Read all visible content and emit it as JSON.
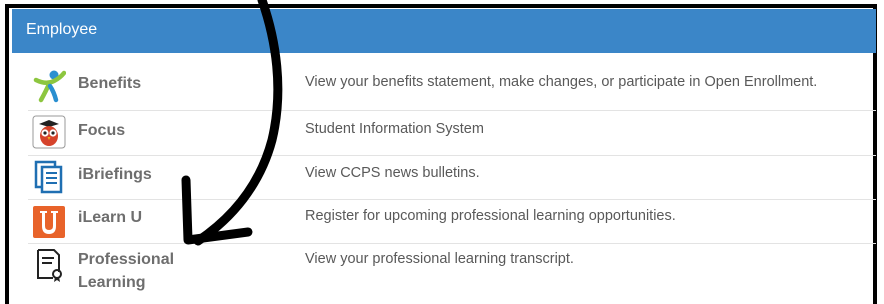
{
  "panel": {
    "title": "Employee"
  },
  "rows": [
    {
      "name": "Benefits",
      "icon": "benefits-person-icon",
      "description": "View your benefits statement, make changes, or participate in Open Enrollment."
    },
    {
      "name": "Focus",
      "icon": "focus-owl-icon",
      "description": "Student Information System"
    },
    {
      "name": "iBriefings",
      "icon": "document-stack-icon",
      "description": "View CCPS news bulletins."
    },
    {
      "name": "iLearn U",
      "icon": "letter-u-icon",
      "description": "Register for upcoming professional learning opportunities."
    },
    {
      "name": "Professional\nLearning",
      "icon": "certificate-icon",
      "description": "View your professional learning transcript."
    }
  ],
  "colors": {
    "header": "#3b86c8",
    "arrow": "#000000",
    "ilearn_orange": "#e8632a",
    "ibriefings_blue": "#1f6fb2"
  }
}
